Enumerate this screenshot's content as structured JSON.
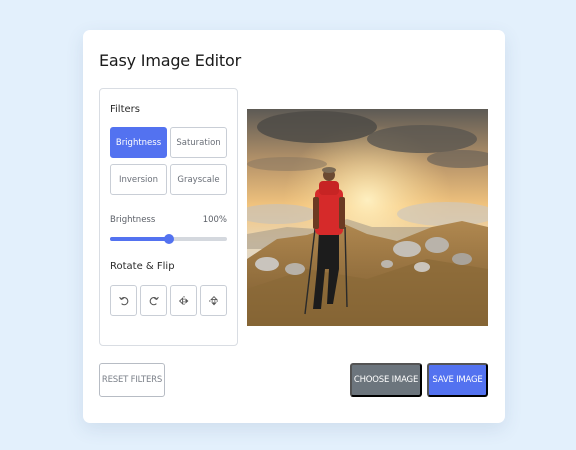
{
  "app": {
    "title": "Easy Image Editor"
  },
  "filters": {
    "heading": "Filters",
    "options": [
      {
        "label": "Brightness",
        "active": true
      },
      {
        "label": "Saturation",
        "active": false
      },
      {
        "label": "Inversion",
        "active": false
      },
      {
        "label": "Grayscale",
        "active": false
      }
    ],
    "slider": {
      "label": "Brightness",
      "value_text": "100%",
      "level_fraction": 0.5
    }
  },
  "rotate_flip": {
    "heading": "Rotate & Flip",
    "buttons": [
      {
        "icon": "rotate-left-icon"
      },
      {
        "icon": "rotate-right-icon"
      },
      {
        "icon": "flip-horizontal-icon"
      },
      {
        "icon": "flip-vertical-icon"
      }
    ]
  },
  "preview": {
    "subject": "hiker with red backpack walking on rocky hillside at sunset"
  },
  "actions": {
    "reset_label": "RESET FILTERS",
    "choose_label": "CHOOSE IMAGE",
    "save_label": "SAVE IMAGE"
  },
  "colors": {
    "accent": "#5372f0",
    "secondary": "#6c757d",
    "page_bg": "#e3f0fc"
  }
}
